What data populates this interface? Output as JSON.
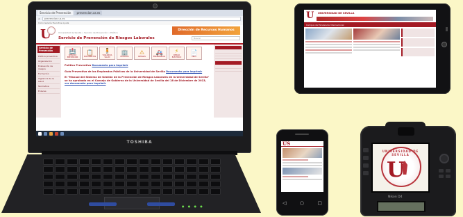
{
  "laptop": {
    "brand": "TOSHIBA",
    "browser": {
      "tabs": [
        "Servicio de Prevención",
        "prevencion.us.es"
      ],
      "address": "prevencion.us.es",
      "bookmarks": "Inicio  Galería  Favoritos  Ayuda"
    },
    "site": {
      "crumb": "Universidad de Sevilla » Servicio de Prevención » Política",
      "title": "Servicio de Prevención de Riesgos Laborales",
      "banner": "Dirección de Recursos Humanos",
      "search_placeholder": "Buscar",
      "left_menu_header": "Servicio de Prevención",
      "left_menu": [
        "Política preventiva",
        "Organización",
        "Evaluación de riesgos",
        "Formación",
        "Vigilancia de la salud",
        "Normativa",
        "Enlaces"
      ],
      "icon_tiles": [
        {
          "glyph": "🏥",
          "label": "SERVICIO PREVENCIÓN"
        },
        {
          "glyph": "📋",
          "label": "DOCUMENTOS"
        },
        {
          "glyph": "🧍",
          "label": "VIGILANCIA SALUD"
        },
        {
          "glyph": "🏢",
          "label": "EDIFICIOS"
        },
        {
          "glyph": "⚠",
          "label": "RIESGOS"
        },
        {
          "glyph": "🚑",
          "label": "EMERGENCIAS"
        },
        {
          "glyph": "⚡",
          "label": "RIESGO ELÉCTRICO"
        },
        {
          "glyph": "📄",
          "label": "PRUS"
        }
      ],
      "paragraphs": [
        {
          "text": "Política Preventiva ",
          "link": "Documento para imprimir"
        },
        {
          "text": "Guía Preventiva de los Empleados Públicos de la Universidad de Sevilla ",
          "link": "Documento para imprimir"
        },
        {
          "text": "El \"Manual del Sistema de Gestión de la Prevención de Riesgos Laborales de la Universidad de Sevilla\" se ha aprobado en el Consejo de Gobierno de la Universidad de Sevilla del 18 de Diciembre de 2013, ",
          "link": "ver documento para imprimir"
        }
      ]
    }
  },
  "tablet": {
    "title": "UNIVERSIDAD DE SEVILLA",
    "nav": "Campus de Excelencia Internacional"
  },
  "phone": {
    "logo": "US",
    "keys": [
      "◁",
      "○",
      "▢"
    ]
  },
  "camera": {
    "seal_text": "UNIVERSIDAD DE SEVILLA",
    "logo_letter": "U",
    "model": "Nikon D4"
  }
}
